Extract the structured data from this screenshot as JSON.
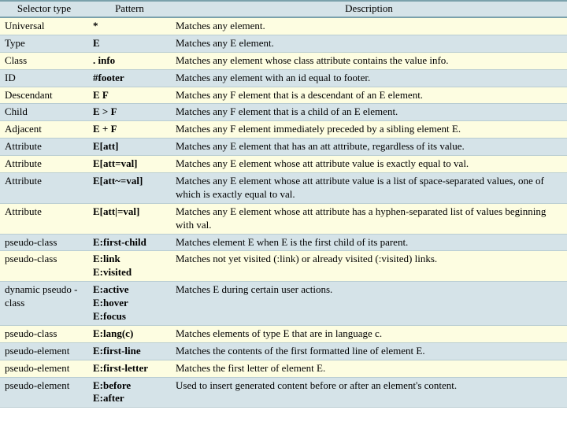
{
  "headers": {
    "c1": "Selector type",
    "c2": "Pattern",
    "c3": "Description"
  },
  "rows": [
    {
      "type": "Universal",
      "pattern": "*",
      "desc": "Matches any element."
    },
    {
      "type": "Type",
      "pattern": "E",
      "desc": "Matches any E element."
    },
    {
      "type": "Class",
      "pattern": ". info",
      "desc": "Matches any element whose class attribute contains the value info."
    },
    {
      "type": "ID",
      "pattern": "#footer",
      "desc": "Matches any element with an id equal to footer."
    },
    {
      "type": "Descendant",
      "pattern": "E F",
      "desc": "Matches any F element that is a descendant of an E element."
    },
    {
      "type": "Child",
      "pattern": "E > F",
      "desc": "Matches any F element that is a child of an E element."
    },
    {
      "type": "Adjacent",
      "pattern": "E + F",
      "desc": "Matches any F element immediately preceded by a sibling element E."
    },
    {
      "type": "Attribute",
      "pattern": "E[att]",
      "desc": "Matches any E element that has an att attribute, regardless of its value."
    },
    {
      "type": "Attribute",
      "pattern": "E[att=val]",
      "desc": "Matches any E element whose att attribute value is exactly equal to val."
    },
    {
      "type": "Attribute",
      "pattern": "E[att~=val]",
      "desc": "Matches any E element whose att attribute value is a list of space-separated values, one of which is exactly equal to val."
    },
    {
      "type": "Attribute",
      "pattern": "E[att|=val]",
      "desc": "Matches any E element whose att attribute has a hyphen-separated list of values beginning with val."
    },
    {
      "type": "pseudo-class",
      "pattern": "E:first-child",
      "desc": "Matches element E when E is the first child of its parent."
    },
    {
      "type": "pseudo-class",
      "pattern": "E:link\nE:visited",
      "desc": "Matches not yet visited (:link) or already visited (:visited) links."
    },
    {
      "type": "dynamic pseudo -class",
      "pattern": "E:active\nE:hover\nE:focus",
      "desc": "Matches E during certain user actions."
    },
    {
      "type": "pseudo-class",
      "pattern": "E:lang(c)",
      "desc": "Matches elements of type E that are in language c."
    },
    {
      "type": "pseudo-element",
      "pattern": "E:first-line",
      "desc": "Matches the contents of the first formatted line of element E."
    },
    {
      "type": "pseudo-element",
      "pattern": "E:first-letter",
      "desc": "Matches the first letter of element E."
    },
    {
      "type": "pseudo-element",
      "pattern": "E:before\nE:after",
      "desc": "Used to insert generated content before or after an element's content."
    }
  ]
}
